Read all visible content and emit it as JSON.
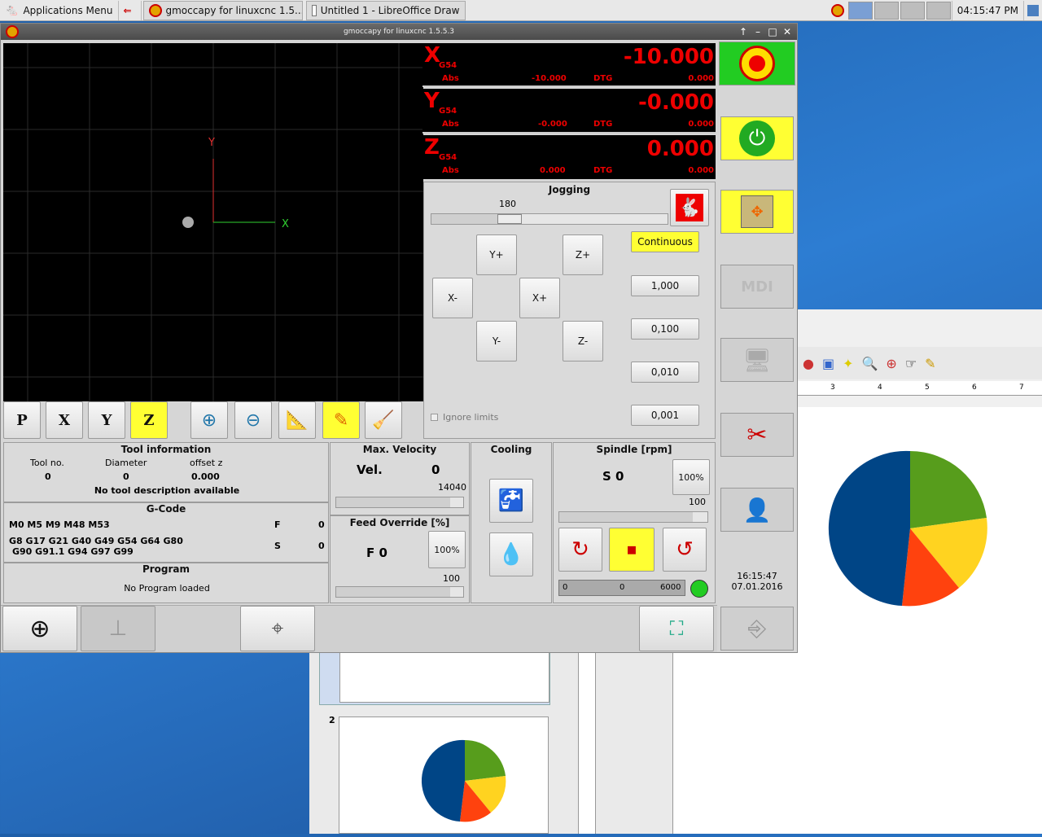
{
  "taskbar": {
    "apps_menu": "Applications Menu",
    "task1": "gmoccapy for linuxcnc  1.5....",
    "task2": "Untitled 1 - LibreOffice Draw",
    "clock": "04:15:47 PM"
  },
  "window": {
    "title": "gmoccapy for linuxcnc  1.5.5.3"
  },
  "dro": [
    {
      "axis": "X",
      "coord": "G54",
      "abs_label": "Abs",
      "big": "-10.000",
      "abs": "-10.000",
      "dtg_label": "DTG",
      "dtg": "0.000"
    },
    {
      "axis": "Y",
      "coord": "G54",
      "abs_label": "Abs",
      "big": "-0.000",
      "abs": "-0.000",
      "dtg_label": "DTG",
      "dtg": "0.000"
    },
    {
      "axis": "Z",
      "coord": "G54",
      "abs_label": "Abs",
      "big": "0.000",
      "abs": "0.000",
      "dtg_label": "DTG",
      "dtg": "0.000"
    }
  ],
  "preview": {
    "axis_x": "X",
    "axis_y": "Y"
  },
  "preview_toolbar": {
    "p": "P",
    "x": "X",
    "y": "Y",
    "z": "Z"
  },
  "jogging": {
    "title": "Jogging",
    "speed": "180",
    "slider_level": 0.33,
    "yplus": "Y+",
    "yminus": "Y-",
    "xminus": "X-",
    "xplus": "X+",
    "zplus": "Z+",
    "zminus": "Z-",
    "continuous": "Continuous",
    "inc1": "1,000",
    "inc2": "0,100",
    "inc3": "0,010",
    "inc4": "0,001",
    "ignore_limits": "Ignore limits"
  },
  "tool": {
    "title": "Tool information",
    "h_no": "Tool no.",
    "h_dia": "Diameter",
    "h_off": "offset z",
    "no": "0",
    "dia": "0",
    "off": "0.000",
    "desc": "No tool description available"
  },
  "gcode": {
    "title": "G-Code",
    "mcodes": "M0 M5 M9 M48 M53",
    "gcodes1": "G8 G17 G21 G40 G49 G54 G64 G80",
    "gcodes2": "G90 G91.1 G94 G97 G99",
    "f_label": "F",
    "f_val": "0",
    "s_label": "S",
    "s_val": "0"
  },
  "program": {
    "title": "Program",
    "status": "No Program loaded"
  },
  "velocity": {
    "title": "Max. Velocity",
    "label": "Vel.",
    "value": "0",
    "max": "14040",
    "level": 0.9
  },
  "feed": {
    "title": "Feed Override [%]",
    "label": "F  0",
    "pct": "100%",
    "value": "100",
    "level": 0.9
  },
  "cooling": {
    "title": "Cooling"
  },
  "spindle": {
    "title": "Spindle [rpm]",
    "label": "S 0",
    "pct": "100%",
    "value": "100",
    "level": 0.9,
    "bar_min": "0",
    "bar_cur": "0",
    "bar_max": "6000"
  },
  "side": {
    "mdi": "MDI",
    "time": "16:15:47",
    "date": "07.01.2016"
  },
  "colors": {
    "dro_red": "#ff1a1a",
    "highlight": "#ffff33",
    "estop_green": "#22cc22"
  },
  "lo": {
    "page_num": "2",
    "ruler": [
      "3",
      "4",
      "5",
      "6",
      "7"
    ]
  }
}
